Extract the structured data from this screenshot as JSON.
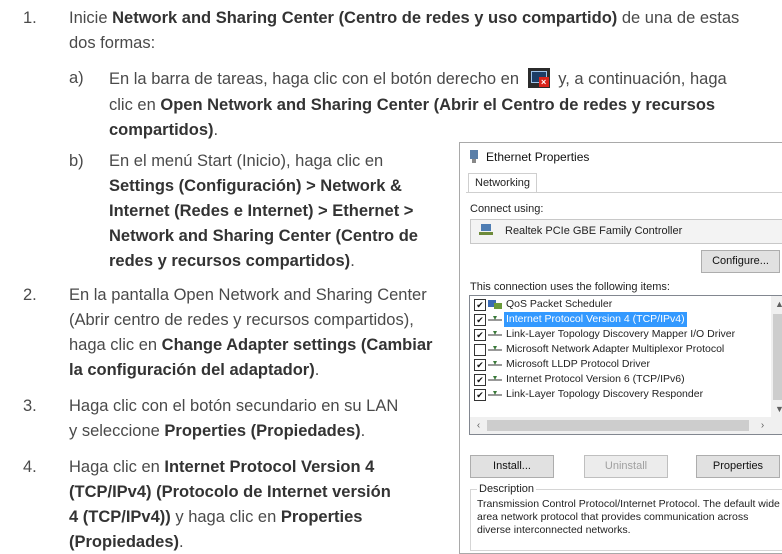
{
  "steps": [
    {
      "number": "1.",
      "text_a": "Inicie ",
      "bold_a": "Network and Sharing Center (Centro de redes y uso compartido)",
      "text_b": " de una de estas",
      "line2": "dos formas:"
    },
    {
      "number": "2.",
      "line1": "En la pantalla Open Network and Sharing Center",
      "line2": "(Abrir centro de redes y recursos compartidos),",
      "line3_text": "haga clic en ",
      "line3_bold": "Change Adapter settings (Cambiar",
      "line4_bold": "la configuración del adaptador)",
      "line4_end": "."
    },
    {
      "number": "3.",
      "line1": "Haga clic con el botón secundario en su LAN",
      "line2_text": "y seleccione ",
      "line2_bold": "Properties (Propiedades)",
      "line2_end": "."
    },
    {
      "number": "4.",
      "line1_text": "Haga clic en ",
      "line1_bold": "Internet Protocol Version 4",
      "line2_bold": "(TCP/IPv4) (Protocolo de Internet versión",
      "line3_bold": "4 (TCP/IPv4))",
      "line3_text": " y haga clic en ",
      "line3_bold2": "Properties",
      "line4_bold": "(Propiedades)",
      "line4_end": "."
    }
  ],
  "substeps": [
    {
      "letter": "a)",
      "l1_text": "En la barra de tareas, haga clic con el botón derecho en ",
      "l1_after": " y, a continuación, haga",
      "l2_text": "clic en ",
      "l2_bold": "Open Network and Sharing Center (Abrir el Centro de redes y recursos",
      "l3_bold": "compartidos)",
      "l3_end": "."
    },
    {
      "letter": "b)",
      "l1": "En el menú Start (Inicio), haga clic en",
      "l2_bold": "Settings (Configuración) > Network &",
      "l3_bold": "Internet (Redes e Internet) > Ethernet >",
      "l4_bold": "Network and Sharing Center (Centro de",
      "l5_bold": "redes y recursos compartidos)",
      "l5_end": "."
    }
  ],
  "dialog": {
    "title": "Ethernet Properties",
    "tab": "Networking",
    "connect_using_label": "Connect using:",
    "adapter_name": "Realtek PCIe GBE Family Controller",
    "configure_button": "Configure...",
    "items_label": "This connection uses the following items:",
    "items": [
      {
        "label": "QoS Packet Scheduler",
        "checked": "✔",
        "selected": false
      },
      {
        "label": "Internet Protocol Version 4 (TCP/IPv4)",
        "checked": "✔",
        "selected": true
      },
      {
        "label": "Link-Layer Topology Discovery Mapper I/O Driver",
        "checked": "✔",
        "selected": false
      },
      {
        "label": "Microsoft Network Adapter Multiplexor Protocol",
        "checked": "",
        "selected": false
      },
      {
        "label": "Microsoft LLDP Protocol Driver",
        "checked": "✔",
        "selected": false
      },
      {
        "label": "Internet Protocol Version 6 (TCP/IPv6)",
        "checked": "✔",
        "selected": false
      },
      {
        "label": "Link-Layer Topology Discovery Responder",
        "checked": "✔",
        "selected": false
      }
    ],
    "install_button": "Install...",
    "uninstall_button": "Uninstall",
    "properties_button": "Properties",
    "description_legend": "Description",
    "description_text": "Transmission Control Protocol/Internet Protocol. The default wide area network protocol that provides communication across diverse interconnected networks."
  },
  "colors": {
    "selection": "#3399ff",
    "tray_alert": "#d9241b"
  }
}
